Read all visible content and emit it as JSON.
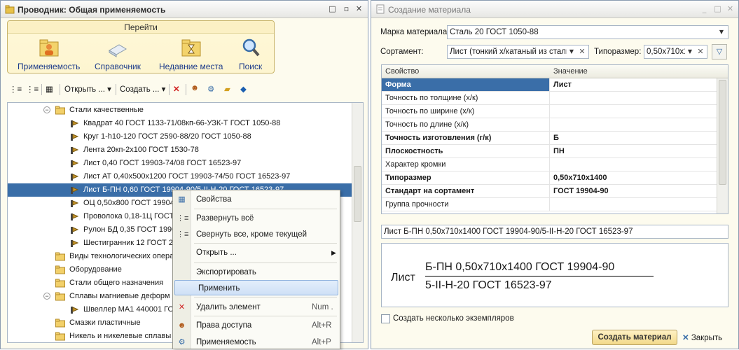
{
  "left_window": {
    "title": "Проводник: Общая применяемость",
    "nav": {
      "header": "Перейти",
      "items": [
        {
          "label": "Применяемость",
          "icon": "people-folder-icon"
        },
        {
          "label": "Справочник",
          "icon": "book-icon"
        },
        {
          "label": "Недавние места",
          "icon": "hourglass-folder-icon"
        },
        {
          "label": "Поиск",
          "icon": "magnifier-icon"
        }
      ]
    },
    "toolbar": {
      "open": "Открыть ...",
      "create": "Создать ..."
    },
    "tree": [
      {
        "label": "Стали качественные",
        "type": "folder",
        "expanded": true
      },
      {
        "label": "Квадрат 40 ГОСТ 1133-71/08кп-66-УЗК-Т ГОСТ 1050-88",
        "type": "item"
      },
      {
        "label": "Круг 1-h10-120 ГОСТ 2590-88/20 ГОСТ 1050-88",
        "type": "item"
      },
      {
        "label": "Лента 20кп-2х100 ГОСТ 1530-78",
        "type": "item"
      },
      {
        "label": "Лист 0,40 ГОСТ 19903-74/08 ГОСТ 16523-97",
        "type": "item"
      },
      {
        "label": "Лист АТ 0,40х500х1200 ГОСТ 19903-74/50 ГОСТ 16523-97",
        "type": "item"
      },
      {
        "label": "Лист Б-ПН 0,60 ГОСТ 19904-90/5-II-Н-20 ГОСТ 16523-97",
        "type": "item",
        "selected": true
      },
      {
        "label": "ОЦ 0,50х800 ГОСТ 19904",
        "type": "item"
      },
      {
        "label": "Проволока 0,18-1Ц ГОСТ",
        "type": "item"
      },
      {
        "label": "Рулон БД 0,35 ГОСТ 1990",
        "type": "item"
      },
      {
        "label": "Шестигранник 12 ГОСТ 2",
        "type": "item"
      },
      {
        "label": "Виды технологических опера",
        "type": "folder"
      },
      {
        "label": "Оборудование",
        "type": "folder"
      },
      {
        "label": "Стали общего назначения",
        "type": "folder"
      },
      {
        "label": "Сплавы магниевые деформ",
        "type": "folder",
        "expanded": true
      },
      {
        "label": "Швеллер МА1 440001 ГОС",
        "type": "item"
      },
      {
        "label": "Смазки пластичные",
        "type": "folder"
      },
      {
        "label": "Никель и никелевые сплавы",
        "type": "folder"
      }
    ],
    "context_menu": [
      {
        "label": "Свойства",
        "icon": "properties-icon",
        "shortcut": ""
      },
      {
        "label": "Развернуть всё",
        "icon": "expand-all-icon",
        "shortcut": ""
      },
      {
        "label": "Свернуть все, кроме текущей",
        "icon": "collapse-all-icon",
        "shortcut": ""
      },
      {
        "label": "Открыть ...",
        "icon": "",
        "shortcut": "",
        "submenu": true
      },
      {
        "label": "Экспортировать",
        "icon": "",
        "shortcut": ""
      },
      {
        "label": "Применить",
        "icon": "",
        "shortcut": "",
        "highlighted": true
      },
      {
        "label": "Удалить элемент",
        "icon": "delete-icon",
        "shortcut": "Num ."
      },
      {
        "label": "Права доступа",
        "icon": "access-rights-icon",
        "shortcut": "Alt+R"
      },
      {
        "label": "Применяемость",
        "icon": "applicability-icon",
        "shortcut": "Alt+P"
      }
    ]
  },
  "right_window": {
    "title": "Создание материала",
    "grade_label": "Марка материала:",
    "grade_value": "Сталь 20 ГОСТ 1050-88",
    "assortment_label": "Сортамент:",
    "assortment_value": "Лист (тонкий х/катаный из стали",
    "size_label": "Типоразмер:",
    "size_value": "0,50х710х1",
    "grid": {
      "col_property": "Свойство",
      "col_value": "Значение",
      "rows": [
        {
          "property": "Форма",
          "value": "Лист",
          "bold": true,
          "selected": true
        },
        {
          "property": "Точность по толщине (х/к)",
          "value": "",
          "bold": false
        },
        {
          "property": "Точность по ширине (х/к)",
          "value": "",
          "bold": false
        },
        {
          "property": "Точность по длине (х/к)",
          "value": "",
          "bold": false
        },
        {
          "property": "Точность изготовления (г/к)",
          "value": "Б",
          "bold": true
        },
        {
          "property": "Плоскостность",
          "value": "ПН",
          "bold": true
        },
        {
          "property": "Характер кромки",
          "value": "",
          "bold": false
        },
        {
          "property": "Типоразмер",
          "value": "0,50х710х1400",
          "bold": true
        },
        {
          "property": "Стандарт на сортамент",
          "value": "ГОСТ 19904-90",
          "bold": true
        },
        {
          "property": "Группа прочности",
          "value": "",
          "bold": false
        }
      ]
    },
    "designation": "Лист Б-ПН 0,50х710х1400 ГОСТ 19904-90/5-II-Н-20 ГОСТ 16523-97",
    "preview": {
      "prefix": "Лист",
      "numerator": "Б-ПН 0,50х710х1400 ГОСТ 19904-90",
      "denominator": "5-II-Н-20 ГОСТ 16523-97"
    },
    "multiple_label": "Создать несколько экземпляров",
    "create_button": "Создать материал",
    "close_button": "Закрыть"
  }
}
